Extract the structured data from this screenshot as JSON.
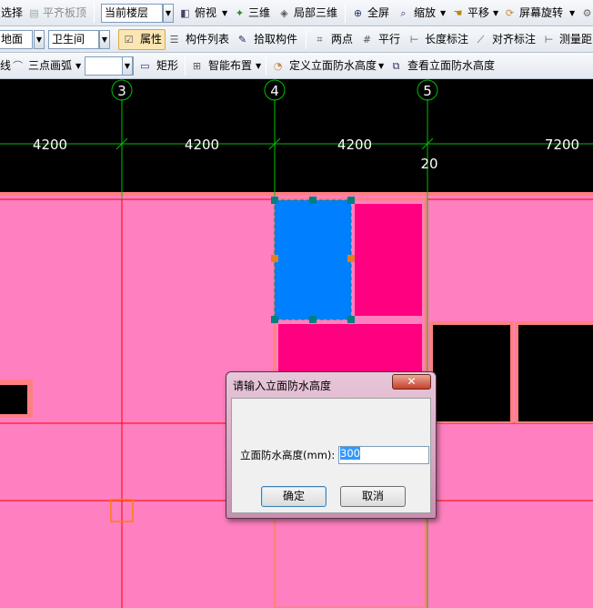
{
  "toolbar1": {
    "select_label": "选择",
    "align_top_label": "平齐板顶",
    "floor_combo_value": "当前楼层",
    "top_view_label": "俯视",
    "three_d_label": "三维",
    "local_3d_label": "局部三维",
    "fullscreen_label": "全屏",
    "zoom_label": "缩放",
    "pan_label": "平移",
    "rotate_label": "屏幕旋转"
  },
  "toolbar2": {
    "category_combo_value": "地面",
    "room_combo_value": "卫生间",
    "properties_label": "属性",
    "component_list_label": "构件列表",
    "pick_component_label": "拾取构件",
    "two_points_label": "两点",
    "parallel_label": "平行",
    "length_dim_label": "长度标注",
    "aligned_dim_label": "对齐标注",
    "measure_label": "测量距"
  },
  "toolbar3": {
    "line_label": "线",
    "arc_combo_value": "三点画弧",
    "shape_combo_value": "",
    "rect_label": "矩形",
    "smart_layout_label": "智能布置",
    "define_height_label": "定义立面防水高度",
    "view_height_label": "查看立面防水高度"
  },
  "grid": {
    "axis_labels": [
      "3",
      "4",
      "5"
    ],
    "dimensions": [
      "4200",
      "4200",
      "4200",
      "7200"
    ],
    "annotation": "20"
  },
  "dialog": {
    "title": "请输入立面防水高度",
    "close_glyph": "✕",
    "field_label": "立面防水高度(mm):",
    "field_value": "300",
    "ok_label": "确定",
    "cancel_label": "取消"
  },
  "colors": {
    "canvas_bg": "#000000",
    "floor_fill": "#ff80c0",
    "selected_fill": "#0080ff",
    "wet_area_fill": "#ff0080",
    "grid_line": "#00c000",
    "wall_line": "#ff0000"
  }
}
